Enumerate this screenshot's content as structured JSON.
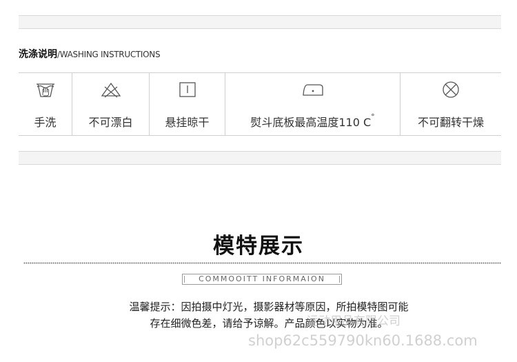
{
  "washing": {
    "title_cn": "洗涤说明",
    "title_en": "/WASHING INSTRUCTIONS",
    "items": [
      {
        "icon": "hand-wash-icon",
        "label": "手洗"
      },
      {
        "icon": "no-bleach-icon",
        "label": "不可漂白"
      },
      {
        "icon": "line-dry-icon",
        "label": "悬挂晾干"
      },
      {
        "icon": "iron-icon",
        "label": "熨斗底板最高温度110 C",
        "sup": "°"
      },
      {
        "icon": "no-tumble-dry-icon",
        "label": "不可翻转干燥"
      }
    ]
  },
  "model": {
    "title": "模特展示",
    "subtitle": "COMMOOITT INFORMAION"
  },
  "tip": {
    "line1": "温馨提示：因拍摄中灯光，摄影器材等原因，所拍模特图可能",
    "line2": "存在细微色差，请给予谅解。产品颜色以实物为准。"
  },
  "watermark": {
    "company": "运动用品有限公司",
    "url": "shop62c559790kn60.1688.com"
  }
}
